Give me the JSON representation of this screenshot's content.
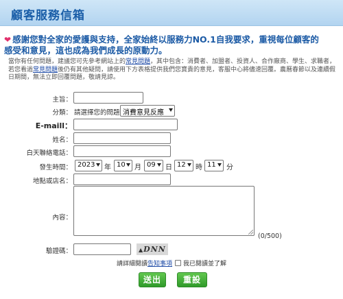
{
  "header": {
    "title": "顧客服務信箱"
  },
  "intro": {
    "line1": "感謝您對全家的愛護與支持，全家始終以服務力NO.1自我要求，重視每位顧客的",
    "line2": "感受和意見，這也成為我們成長的原動力。"
  },
  "description": {
    "part1": "當你有任何問題，建議您可先參考網站上的",
    "link1": "常見問題",
    "part2": "，其中包含：消費者、加盟者、投資人、合作廠商、學生、求職者，若您看過",
    "link2": "常見問題",
    "part3": "後仍有其他疑問，請使用下方表格提供我們您寶貴的意見，客服中心將儘速回覆。農曆春節以及連續假日期間，無法立即回覆問題，敬請見諒。"
  },
  "form": {
    "subject_label": "主旨：",
    "category_label": "分類：",
    "category_hint": "請選擇您的問題",
    "category_value": "消費意見反應",
    "email_label": "E-maill：",
    "name_label": "姓名：",
    "phone_label": "白天聯絡電話：",
    "time_label": "發生時間：",
    "year": "2023",
    "year_unit": "年",
    "month": "10",
    "month_unit": "月",
    "day": "09",
    "day_unit": "日",
    "hour": "12",
    "hour_unit": "時",
    "minute": "11",
    "minute_unit": "分",
    "store_label": "地點或店名：",
    "content_label": "內容：",
    "counter": "(0/500)",
    "captcha_label": "驗證碼：",
    "captcha_text": "DNN",
    "agree_prefix": "請詳細閱讀",
    "agree_link": "告知事項",
    "agree_suffix": "我已閱讀並了解"
  },
  "buttons": {
    "submit": "送出",
    "reset": "重設"
  }
}
